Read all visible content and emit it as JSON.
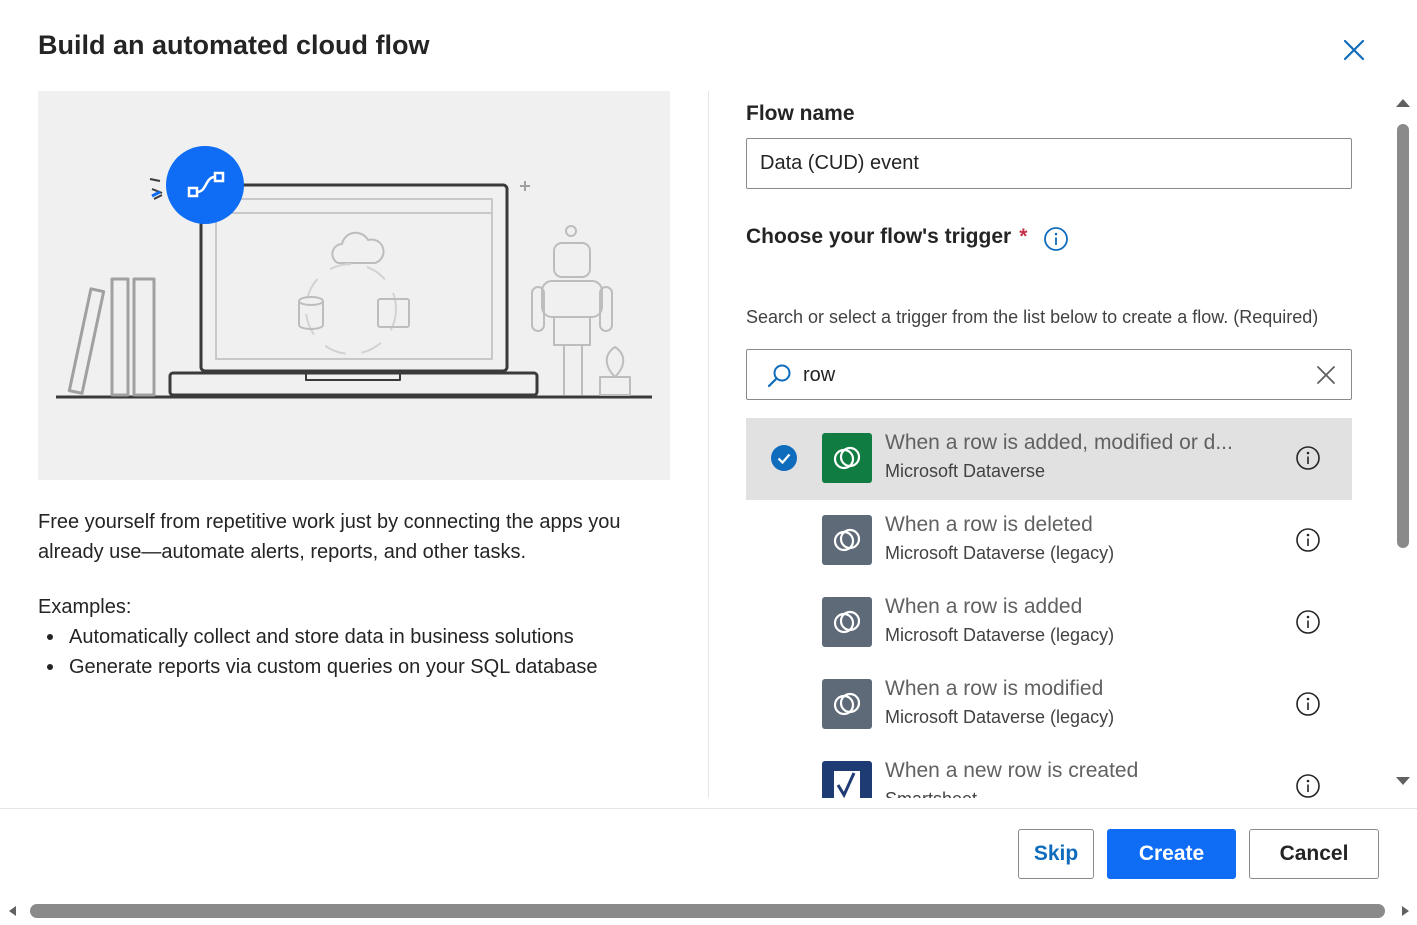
{
  "dialog": {
    "title": "Build an automated cloud flow",
    "close_icon": "close-icon"
  },
  "left": {
    "illustration": "laptop-robot-illustration",
    "description": "Free yourself from repetitive work just by connecting the apps you already use—automate alerts, reports, and other tasks.",
    "examples_label": "Examples:",
    "examples": [
      "Automatically collect and store data in business solutions",
      "Generate reports via custom queries on your SQL database"
    ]
  },
  "form": {
    "flow_name_label": "Flow name",
    "flow_name_value": "Data (CUD) event",
    "trigger_label": "Choose your flow's trigger",
    "required_mark": "*",
    "help_text": "Search or select a trigger from the list below to create a flow. (Required)",
    "search_value": "row"
  },
  "triggers": [
    {
      "name": "When a row is added, modified or d...",
      "connector": "Microsoft Dataverse",
      "selected": true,
      "icon": "dataverse-icon",
      "color": "#107c41"
    },
    {
      "name": "When a row is deleted",
      "connector": "Microsoft Dataverse (legacy)",
      "selected": false,
      "icon": "dataverse-legacy-icon",
      "color": "#5e6a78"
    },
    {
      "name": "When a row is added",
      "connector": "Microsoft Dataverse (legacy)",
      "selected": false,
      "icon": "dataverse-legacy-icon",
      "color": "#5e6a78"
    },
    {
      "name": "When a row is modified",
      "connector": "Microsoft Dataverse (legacy)",
      "selected": false,
      "icon": "dataverse-legacy-icon",
      "color": "#5e6a78"
    },
    {
      "name": "When a new row is created",
      "connector": "Smartsheet",
      "selected": false,
      "icon": "smartsheet-icon",
      "color": "#1f3b73"
    }
  ],
  "footer": {
    "skip_label": "Skip",
    "create_label": "Create",
    "cancel_label": "Cancel"
  },
  "colors": {
    "accent": "#0f6cbd",
    "primary_button": "#0f6cf5",
    "selected_row": "#e1e1e1"
  }
}
